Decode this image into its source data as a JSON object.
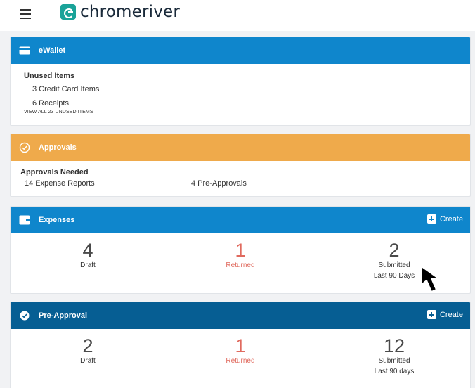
{
  "header": {
    "brand": "chromeriver"
  },
  "ewallet": {
    "title": "eWallet",
    "section_title": "Unused Items",
    "items": [
      "3 Credit Card Items",
      "6 Receipts"
    ],
    "view_all": "VIEW ALL 23 UNUSED ITEMS"
  },
  "approvals": {
    "title": "Approvals",
    "section_title": "Approvals Needed",
    "expense_reports": "14 Expense Reports",
    "pre_approvals": "4 Pre-Approvals"
  },
  "expenses": {
    "title": "Expenses",
    "create_label": "Create",
    "stats": [
      {
        "value": "4",
        "label": "Draft",
        "sub": ""
      },
      {
        "value": "1",
        "label": "Returned",
        "sub": ""
      },
      {
        "value": "2",
        "label": "Submitted",
        "sub": "Last 90 Days"
      }
    ]
  },
  "pre_approval": {
    "title": "Pre-Approval",
    "create_label": "Create",
    "stats": [
      {
        "value": "2",
        "label": "Draft",
        "sub": ""
      },
      {
        "value": "1",
        "label": "Returned",
        "sub": ""
      },
      {
        "value": "12",
        "label": "Submitted",
        "sub": "Last 90 days"
      }
    ]
  },
  "colors": {
    "ewallet_header": "#0f86cc",
    "approvals_header": "#efaa4b",
    "expenses_header": "#0f86cc",
    "pre_approval_header": "#065e93",
    "returned": "#e06a5e",
    "brand": "#1aa399"
  },
  "icons": {
    "menu": "hamburger-icon",
    "brand": "chromeriver-logo-icon",
    "ewallet": "wallet-card-icon",
    "approvals": "check-circle-icon",
    "expenses": "wallet-icon",
    "pre_approval": "badge-check-icon",
    "create": "plus-square-icon",
    "pointer": "mouse-pointer-icon"
  }
}
